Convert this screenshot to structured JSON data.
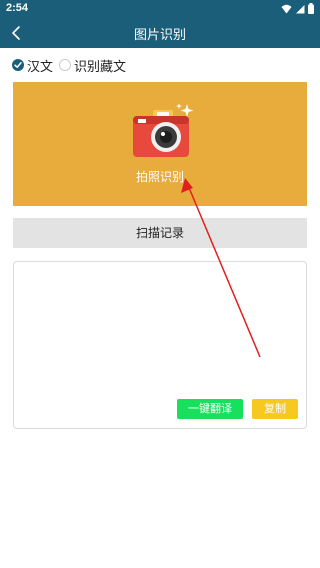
{
  "status_bar": {
    "time": "2:54"
  },
  "app_bar": {
    "title": "图片识别"
  },
  "language_options": [
    {
      "label": "汉文",
      "checked": true
    },
    {
      "label": "识别藏文",
      "checked": false
    }
  ],
  "photo_area": {
    "label": "拍照识别"
  },
  "scan_history_button": {
    "label": "扫描记录"
  },
  "result": {
    "text": "",
    "translate_label": "一键翻译",
    "copy_label": "复制"
  },
  "colors": {
    "app_bar": "#1a5e7a",
    "photo_area": "#e8ac3c",
    "camera_body": "#e8493d",
    "translate_button": "#19e05c",
    "copy_button": "#f7c81f",
    "annotation_arrow": "#e02020"
  },
  "icons": [
    "wifi-icon",
    "signal-icon",
    "battery-icon",
    "back-arrow-icon",
    "camera-icon",
    "sparkle-icon"
  ]
}
